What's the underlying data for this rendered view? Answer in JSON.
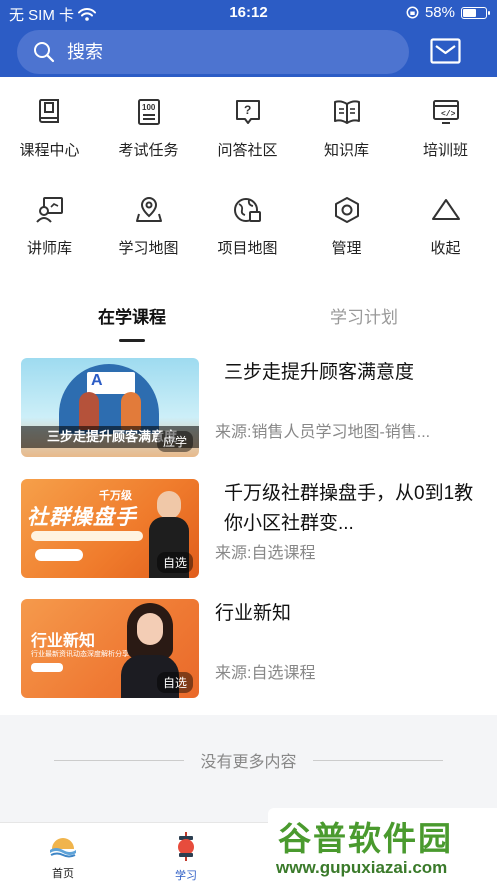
{
  "status_bar": {
    "carrier": "无 SIM 卡",
    "time": "16:12",
    "battery": "58%",
    "battery_level": 0.58
  },
  "search": {
    "placeholder": "搜索"
  },
  "grid": [
    {
      "label": "课程中心",
      "icon": "course-center-icon"
    },
    {
      "label": "考试任务",
      "icon": "exam-task-icon"
    },
    {
      "label": "问答社区",
      "icon": "qa-community-icon"
    },
    {
      "label": "知识库",
      "icon": "knowledge-base-icon"
    },
    {
      "label": "培训班",
      "icon": "training-class-icon"
    },
    {
      "label": "讲师库",
      "icon": "lecturer-icon"
    },
    {
      "label": "学习地图",
      "icon": "learning-map-icon"
    },
    {
      "label": "项目地图",
      "icon": "project-map-icon"
    },
    {
      "label": "管理",
      "icon": "manage-icon"
    },
    {
      "label": "收起",
      "icon": "collapse-icon"
    }
  ],
  "tabs": [
    {
      "label": "在学课程",
      "active": true
    },
    {
      "label": "学习计划",
      "active": false
    }
  ],
  "courses": [
    {
      "title": "三步走提升顾客满意度",
      "source": "来源:销售人员学习地图-销售...",
      "tag": "应学",
      "thumb_text": "三步走提升顾客满意度"
    },
    {
      "title": "千万级社群操盘手，从0到1教你小区社群变...",
      "source": "来源:自选课程",
      "tag": "自选",
      "thumb_text": "社群操盘手",
      "thumb_sub": "千万级"
    },
    {
      "title": "行业新知",
      "source": "来源:自选课程",
      "tag": "自选",
      "thumb_text": "行业新知",
      "thumb_sub": "行业最新资讯动态深度解析分享"
    }
  ],
  "footer": {
    "no_more": "没有更多内容"
  },
  "bottom_nav": [
    {
      "label": "首页",
      "icon": "home-icon"
    },
    {
      "label": "学习",
      "icon": "study-icon",
      "active": true
    }
  ],
  "watermark": {
    "title": "谷普软件园",
    "url": "www.gupuxiazai.com"
  },
  "colors": {
    "brand": "#2c5cc5",
    "orange": "#f07a2e",
    "active_tab": "#111111"
  }
}
